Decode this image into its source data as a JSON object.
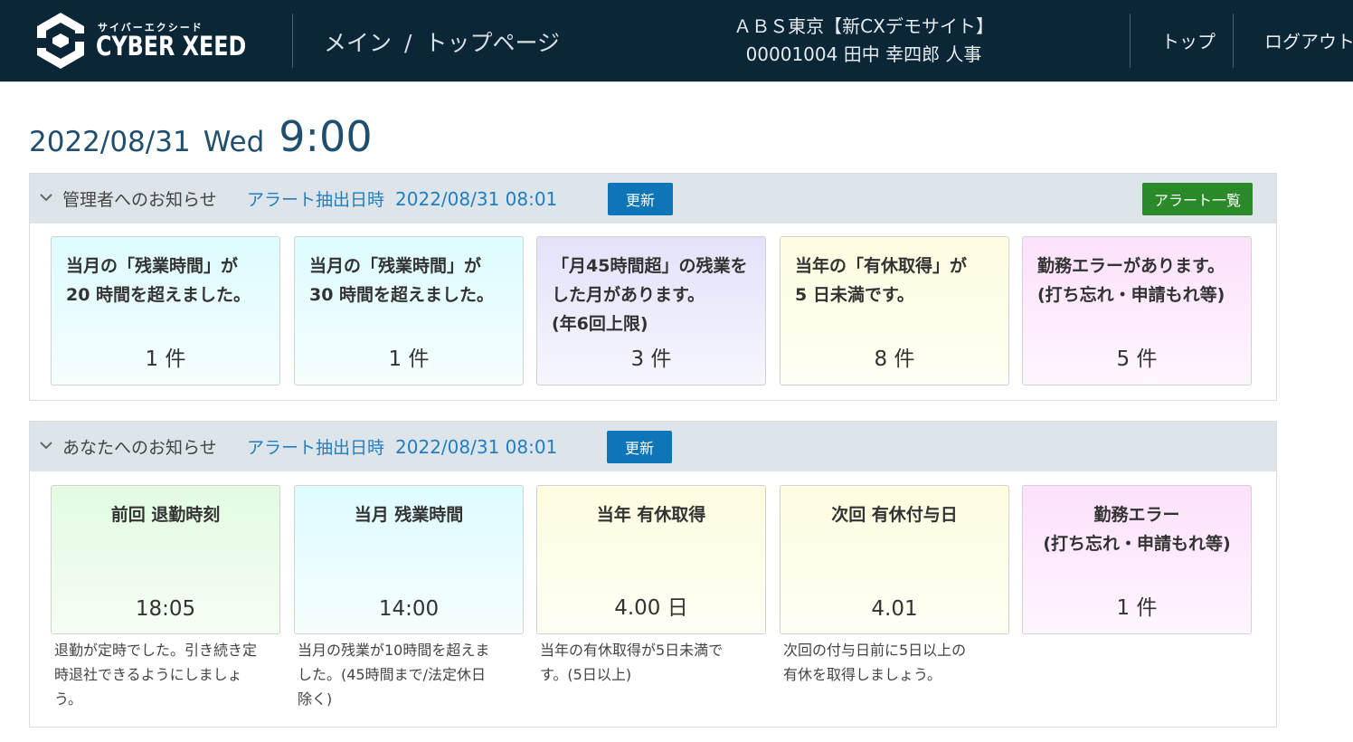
{
  "header": {
    "logo_kana": "サイバーエクシード",
    "logo_text": "CYBER XEED",
    "breadcrumb": [
      "メイン",
      "/",
      "トップページ"
    ],
    "company": "ＡＢＳ東京【新CXデモサイト】",
    "user": "00001004 田中 幸四郎 人事",
    "nav_top": "トップ",
    "nav_logout": "ログアウト"
  },
  "datetime": {
    "date": "2022/08/31",
    "day": "Wed",
    "time": "9:00"
  },
  "admin_panel": {
    "title": "管理者へのお知らせ",
    "alert_label": "アラート抽出日時",
    "alert_date": "2022/08/31 08:01",
    "update_button": "更新",
    "alert_list_button": "アラート一覧",
    "cards": [
      {
        "lines": [
          "当月の「残業時間」が",
          "20 時間を超えました。"
        ],
        "count": "1 件",
        "color": "#ddfcfe"
      },
      {
        "lines": [
          "当月の「残業時間」が",
          "30 時間を超えました。"
        ],
        "count": "1 件",
        "color": "#ddfcfe"
      },
      {
        "lines": [
          "「月45時間超」の残業を",
          "した月があります。",
          "(年6回上限)"
        ],
        "count": "3 件",
        "color": "#e3e2fa"
      },
      {
        "lines": [
          "当年の「有休取得」が",
          "5 日未満です。"
        ],
        "count": "8 件",
        "color": "#fefde0"
      },
      {
        "lines": [
          "勤務エラーがあります。",
          "(打ち忘れ・申請もれ等)"
        ],
        "count": "5 件",
        "color": "#fde1fb"
      }
    ]
  },
  "user_panel": {
    "title": "あなたへのお知らせ",
    "alert_label": "アラート抽出日時",
    "alert_date": "2022/08/31 08:01",
    "update_button": "更新",
    "cards": [
      {
        "lines": [
          "前回 退勤時刻"
        ],
        "value": "18:05",
        "desc": [
          "退勤が定時でした。引き続き定",
          "時退社できるようにしましょう。"
        ],
        "color": "#e3fbe1"
      },
      {
        "lines": [
          "当月 残業時間"
        ],
        "value": "14:00",
        "desc": [
          "当月の残業が10時間を超えま",
          "した。(45時間まで/法定休日",
          "除く)"
        ],
        "color": "#ddfcfe"
      },
      {
        "lines": [
          "当年 有休取得"
        ],
        "value": "4.00 日",
        "desc": [
          "当年の有休取得が5日未満で",
          "す。(5日以上)"
        ],
        "color": "#fefde0"
      },
      {
        "lines": [
          "次回 有休付与日"
        ],
        "value": "4.01",
        "desc": [
          "次回の付与日前に5日以上の",
          "有休を取得しましょう。"
        ],
        "color": "#fefde0"
      },
      {
        "lines": [
          "勤務エラー",
          "(打ち忘れ・申請もれ等)"
        ],
        "value": "1 件",
        "desc": [],
        "color": "#fde1fb"
      }
    ]
  }
}
